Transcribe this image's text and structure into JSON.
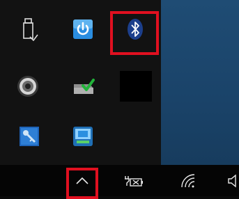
{
  "overflow_tray": {
    "icons": [
      {
        "name": "usb-safely-remove-icon",
        "tooltip": ""
      },
      {
        "name": "power-manager-icon",
        "tooltip": ""
      },
      {
        "name": "bluetooth-icon",
        "tooltip": ""
      },
      {
        "name": "speaker-icon",
        "tooltip": ""
      },
      {
        "name": "network-drive-check-icon",
        "tooltip": ""
      },
      {
        "name": "blank-icon",
        "tooltip": ""
      },
      {
        "name": "key-tool-icon",
        "tooltip": ""
      },
      {
        "name": "device-settings-icon",
        "tooltip": ""
      }
    ],
    "highlighted": [
      "bluetooth-icon"
    ]
  },
  "taskbar": {
    "items": [
      {
        "name": "show-hidden-icons-chevron"
      },
      {
        "name": "battery-unplugged-icon"
      },
      {
        "name": "wifi-icon"
      },
      {
        "name": "volume-icon"
      }
    ],
    "highlighted": [
      "show-hidden-icons-chevron"
    ]
  },
  "colors": {
    "highlight": "#e01020",
    "bluetooth_bg": "#1c3f8c",
    "power_blue": "#2a8de0"
  }
}
